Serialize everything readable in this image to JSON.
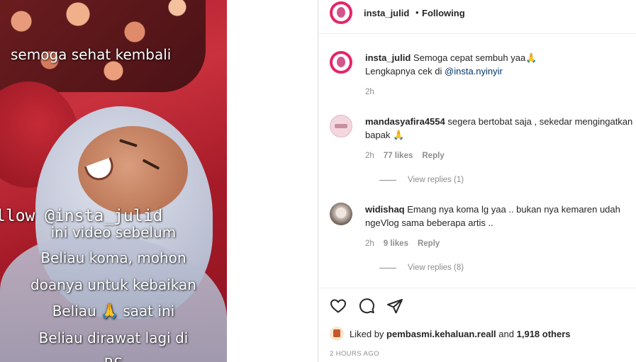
{
  "media": {
    "caption_top": "semoga sehat kembali",
    "caption_follow": "llow @insta_julid",
    "caption_lines": [
      "ini video sebelum",
      "Beliau koma, mohon",
      "doanya untuk kebaikan",
      "Beliau 🙏 saat ini",
      "Beliau dirawat lagi di",
      "RS"
    ]
  },
  "header": {
    "username": "insta_julid",
    "separator": "•",
    "follow_status": "Following"
  },
  "comments": [
    {
      "username": "insta_julid",
      "text_line1": "Semoga cepat sembuh yaa🙏",
      "text_line2_prefix": "Lengkapnya cek di ",
      "mention": "@insta.nyinyir",
      "time": "2h"
    },
    {
      "username": "mandasyafira4554",
      "text": "segera bertobat saja , sekedar mengingatkan bapak 🙏",
      "time": "2h",
      "likes": "77 likes",
      "reply_label": "Reply",
      "view_replies": "View replies (1)"
    },
    {
      "username": "widishaq",
      "text": "Emang nya koma lg yaa .. bukan nya kemaren udah ngeVlog sama beberapa artis ..",
      "time": "2h",
      "likes": "9 likes",
      "reply_label": "Reply",
      "view_replies": "View replies (8)"
    }
  ],
  "likes": {
    "prefix": "Liked by ",
    "user": "pembasmi.kehaluan.reall",
    "middle": " and ",
    "others": "1,918 others"
  },
  "timestamp": "2 HOURS AGO",
  "icons": [
    "heart-icon",
    "comment-icon",
    "share-icon"
  ]
}
